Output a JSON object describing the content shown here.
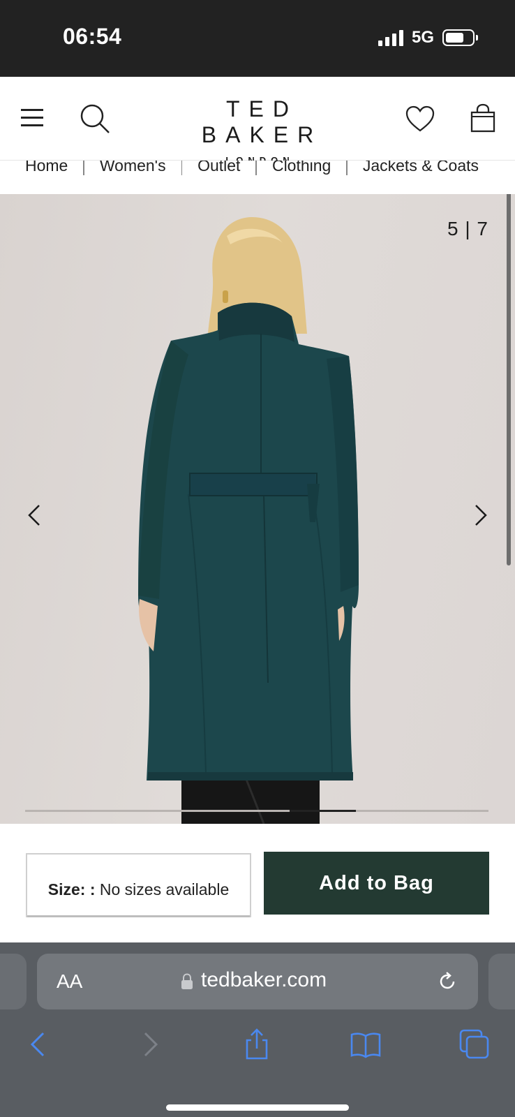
{
  "status_bar": {
    "time": "06:54",
    "network": "5G",
    "battery_level": 0.7
  },
  "header": {
    "brand": "TED BAKER",
    "brand_sub": "LONDON",
    "icons": [
      "menu-icon",
      "search-icon",
      "heart-icon",
      "bag-icon"
    ]
  },
  "breadcrumb": {
    "items": [
      "Home",
      "Women's",
      "Outlet",
      "Clothing",
      "Jackets & Coats"
    ]
  },
  "gallery": {
    "counter": "5 | 7",
    "current": 5,
    "total": 7,
    "image_alt": "Teal long wool coat, back view",
    "colors": {
      "coat": "#1d4a4f",
      "background": "#dcd6d3"
    }
  },
  "product_actions": {
    "size_label": "Size: :",
    "size_value": "No sizes available",
    "add_to_bag": "Add to Bag",
    "button_color": "#233a32"
  },
  "browser": {
    "text_size": "AA",
    "url": "tedbaker.com",
    "toolbar": [
      "back-icon",
      "forward-icon",
      "share-icon",
      "bookmarks-icon",
      "tabs-icon"
    ],
    "accent": "#4a88f0"
  }
}
